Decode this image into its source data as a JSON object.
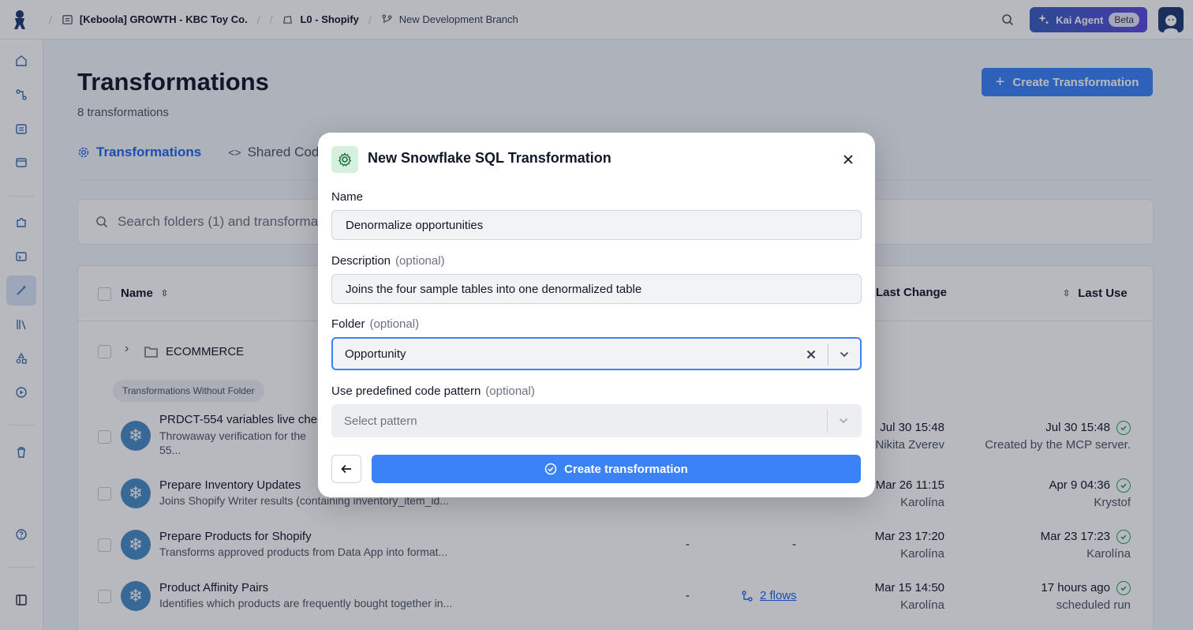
{
  "topbar": {
    "project": "[Keboola] GROWTH - KBC Toy Co.",
    "folder": "L0 - Shopify",
    "branch": "New Development Branch",
    "kai_label": "Kai Agent",
    "beta_label": "Beta"
  },
  "page": {
    "title": "Transformations",
    "count": "8 transformations",
    "create_label": "Create Transformation",
    "tabs": [
      {
        "label": "Transformations"
      },
      {
        "label": "Shared Cod"
      }
    ],
    "search_placeholder": "Search folders (1) and transformat"
  },
  "table": {
    "headers": {
      "name": "Name",
      "last_change": "Last Change",
      "last_use": "Last Use"
    },
    "folder": "ECOMMERCE",
    "chip": "Transformations Without Folder",
    "rows": [
      {
        "name": "PRDCT-554 variables live che",
        "desc": "Throwaway verification for the",
        "desc2": "55...",
        "col1": "",
        "col2": "",
        "change_time": "Jul 30 15:48",
        "change_user": "Nikita Zverev",
        "use_time": "Jul 30 15:48",
        "use_note": "Created by the MCP server."
      },
      {
        "name": "Prepare Inventory Updates",
        "desc": "Joins Shopify Writer results (containing inventory_item_id...",
        "col1": "",
        "col2": "",
        "change_time": "Mar 26 11:15",
        "change_user": "Karolína",
        "use_time": "Apr 9 04:36",
        "use_note": "Krystof"
      },
      {
        "name": "Prepare Products for Shopify",
        "desc": "Transforms approved products from Data App into format...",
        "col1": "-",
        "col2": "-",
        "change_time": "Mar 23 17:20",
        "change_user": "Karolína",
        "use_time": "Mar 23 17:23",
        "use_note": "Karolína"
      },
      {
        "name": "Product Affinity Pairs",
        "desc": "Identifies which products are frequently bought together in...",
        "col1": "-",
        "col2": "2 flows",
        "change_time": "Mar 15 14:50",
        "change_user": "Karolína",
        "use_time": "17 hours ago",
        "use_note": "scheduled run"
      }
    ]
  },
  "modal": {
    "title": "New Snowflake SQL Transformation",
    "name_label": "Name",
    "name_value": "Denormalize opportunities",
    "desc_label": "Description",
    "desc_optional": "(optional)",
    "desc_value": "Joins the four sample tables into one denormalized table",
    "folder_label": "Folder",
    "folder_optional": "(optional)",
    "folder_value": "Opportunity",
    "pattern_label": "Use predefined code pattern",
    "pattern_optional": "(optional)",
    "pattern_placeholder": "Select pattern",
    "submit_label": "Create transformation"
  },
  "colors": {
    "accent": "#3b82f6",
    "success": "#22a559",
    "snowflake": "#4a8dc4"
  }
}
